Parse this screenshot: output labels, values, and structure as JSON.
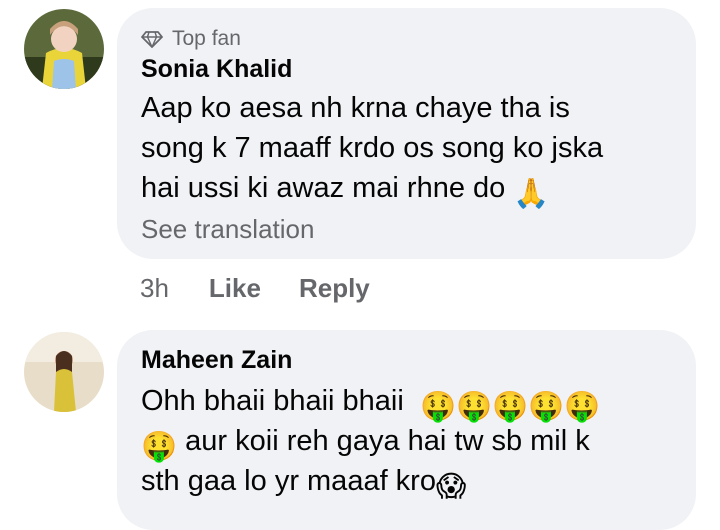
{
  "comments": [
    {
      "badge": "Top fan",
      "badge_icon": "diamond-icon",
      "author": "Sonia Khalid",
      "lines": [
        "Aap ko aesa nh krna chaye tha is",
        "song k 7 maaff krdo os song ko jska",
        "hai ussi ki awaz mai rhne do"
      ],
      "line_emoji": "🙏",
      "see_translation": "See translation",
      "time": "3h",
      "like_label": "Like",
      "reply_label": "Reply"
    },
    {
      "author": "Maheen Zain",
      "line1": "Ohh bhaii bhaii bhaii",
      "line1_emojis": "🤑🤑🤑🤑🤑",
      "line2_emoji": "🤑",
      "line2": "aur koii reh gaya hai tw sb mil k",
      "line3": "sth gaa lo yr maaaf kro",
      "line3_emoji": "😱"
    }
  ],
  "colors": {
    "bubble": "#f0f2f5",
    "primary_text": "#050505",
    "secondary_text": "#65676b",
    "emoji_yellow": "#f7c41f"
  }
}
